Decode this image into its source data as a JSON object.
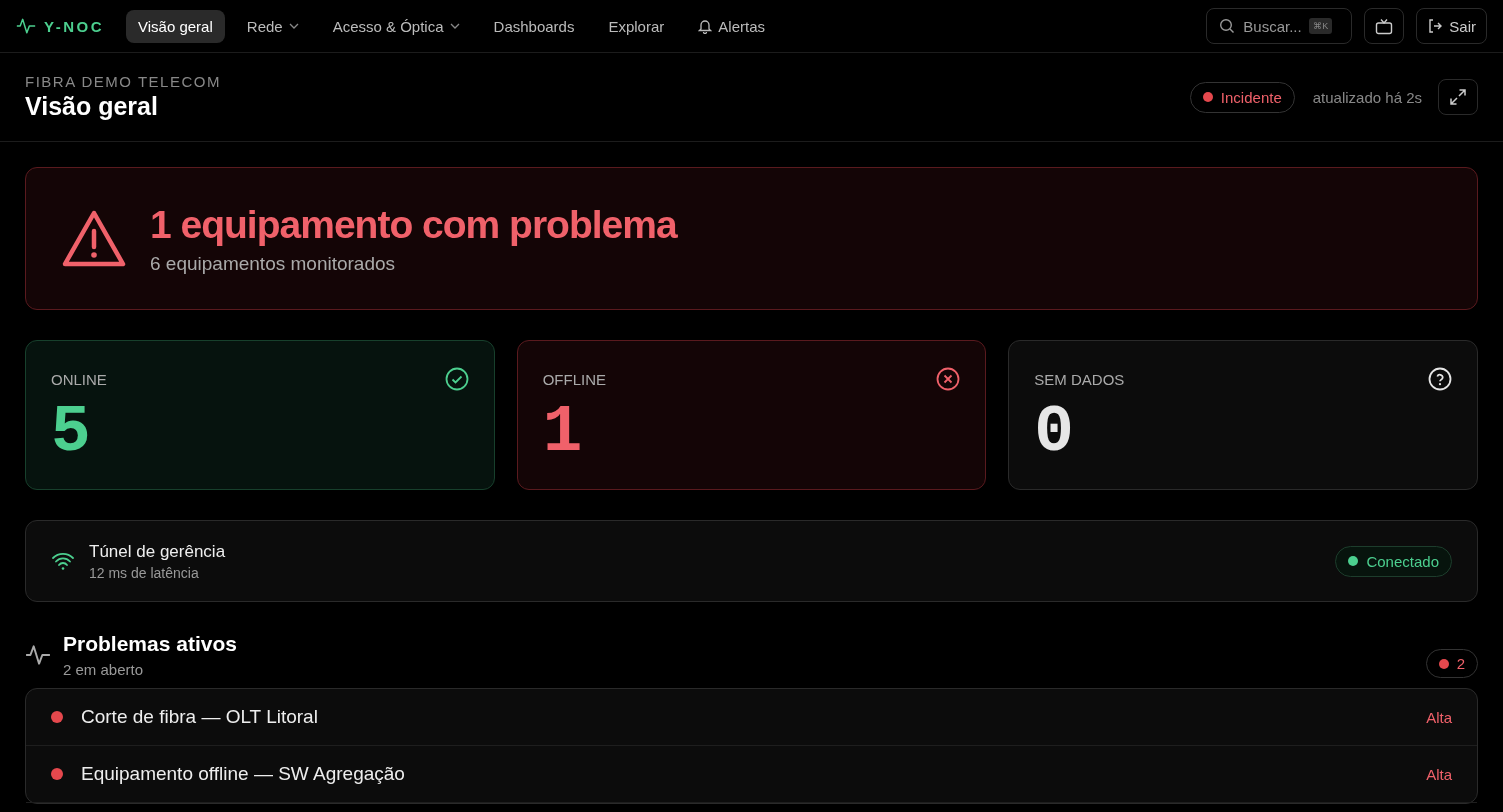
{
  "brand": "Y-NOC",
  "nav": [
    {
      "label": "Visão geral",
      "selected": true,
      "kind": "plain"
    },
    {
      "label": "Rede",
      "selected": false,
      "kind": "dropdown"
    },
    {
      "label": "Acesso & Óptica",
      "selected": false,
      "kind": "dropdown"
    },
    {
      "label": "Dashboards",
      "selected": false,
      "kind": "plain"
    },
    {
      "label": "Explorar",
      "selected": false,
      "kind": "plain"
    },
    {
      "label": "Alertas",
      "selected": false,
      "kind": "bell"
    }
  ],
  "search": {
    "placeholder": "Buscar...",
    "shortcut": "⌘K"
  },
  "logout": "Sair",
  "header": {
    "org": "FIBRA DEMO TELECOM",
    "title": "Visão geral",
    "status": "Incidente",
    "updated": "atualizado há 2s"
  },
  "alert": {
    "title": "1 equipamento com problema",
    "subtitle": "6 equipamentos monitorados"
  },
  "stats": [
    {
      "kind": "online",
      "label": "ONLINE",
      "value": "5"
    },
    {
      "kind": "offline",
      "label": "OFFLINE",
      "value": "1"
    },
    {
      "kind": "nodata",
      "label": "SEM DADOS",
      "value": "0"
    }
  ],
  "tunnel": {
    "title": "Túnel de gerência",
    "subtitle": "12 ms de latência",
    "status": "Conectado"
  },
  "problems": {
    "title": "Problemas ativos",
    "subtitle": "2 em aberto",
    "count": "2",
    "items": [
      {
        "title": "Corte de fibra — OLT Litoral",
        "severity": "Alta",
        "color": "#e5484d"
      },
      {
        "title": "Equipamento offline — SW Agregação",
        "severity": "Alta",
        "color": "#e5484d"
      }
    ]
  }
}
